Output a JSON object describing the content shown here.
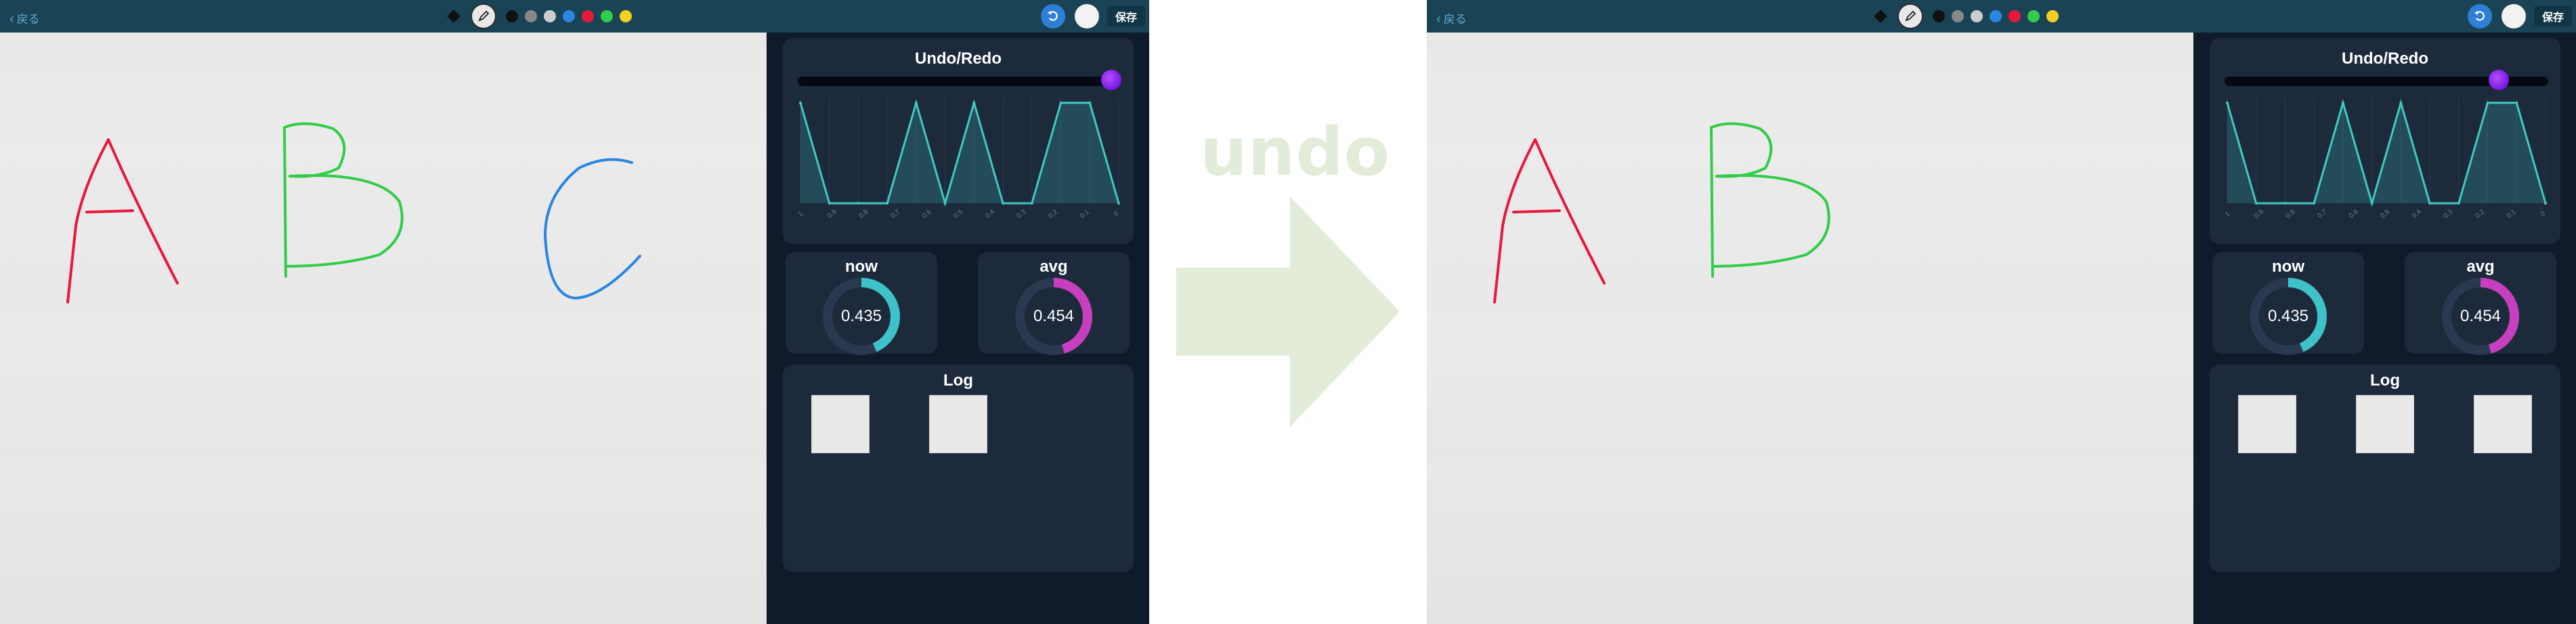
{
  "before": {
    "back_label": "戻る",
    "save_label": "保存",
    "undo_panel_title": "Undo/Redo",
    "slider_position": 1.0,
    "chart_data": {
      "type": "area",
      "x": [
        "1",
        "0.9",
        "0.8",
        "0.7",
        "0.6",
        "0.5",
        "0.4",
        "0.3",
        "0.2",
        "0.1",
        "0"
      ],
      "values": [
        0.95,
        0,
        0,
        0,
        0.95,
        0,
        0.95,
        0,
        0,
        0.95,
        0.95,
        0
      ],
      "x_tick_labels": [
        "1",
        "0.9",
        "0.8",
        "0.7",
        "0.6",
        "0.5",
        "0.4",
        "0.3",
        "0.2",
        "0.1",
        "0"
      ],
      "ylim": [
        0,
        1
      ],
      "line_color": "#3fc9bf"
    },
    "now_card": {
      "title": "now",
      "value": "0.435",
      "ratio": 0.435,
      "color": "#3fc1c9"
    },
    "avg_card": {
      "title": "avg",
      "value": "0.454",
      "ratio": 0.454,
      "color": "#c63fbf"
    },
    "log_title": "Log",
    "log_thumbnail_count": 2,
    "strokes": [
      "A",
      "B",
      "C"
    ],
    "stroke_colors": {
      "A": "#e8183d",
      "B": "#33cc4a",
      "C": "#2b86e0"
    }
  },
  "transition": {
    "label": "undo",
    "color": "#e2ecd9"
  },
  "after": {
    "back_label": "戻る",
    "save_label": "保存",
    "undo_panel_title": "Undo/Redo",
    "slider_position": 0.87,
    "chart_data": {
      "type": "area",
      "x": [
        "1",
        "0.9",
        "0.8",
        "0.7",
        "0.6",
        "0.5",
        "0.4",
        "0.3",
        "0.2",
        "0.1",
        "0"
      ],
      "values": [
        0.95,
        0,
        0,
        0,
        0.95,
        0,
        0.95,
        0,
        0,
        0.95,
        0.95,
        0
      ],
      "x_tick_labels": [
        "1",
        "0.9",
        "0.8",
        "0.7",
        "0.6",
        "0.5",
        "0.4",
        "0.3",
        "0.2",
        "0.1",
        "0"
      ],
      "ylim": [
        0,
        1
      ],
      "line_color": "#3fc9bf"
    },
    "now_card": {
      "title": "now",
      "value": "0.435",
      "ratio": 0.435,
      "color": "#3fc1c9"
    },
    "avg_card": {
      "title": "avg",
      "value": "0.454",
      "ratio": 0.454,
      "color": "#c63fbf"
    },
    "log_title": "Log",
    "log_thumbnail_count": 3,
    "strokes": [
      "A",
      "B"
    ],
    "stroke_colors": {
      "A": "#e8183d",
      "B": "#33cc4a"
    }
  },
  "palette": [
    "#111111",
    "#888888",
    "#cccccc",
    "#2b86e0",
    "#e8183d",
    "#33cc4a",
    "#f5d020"
  ]
}
